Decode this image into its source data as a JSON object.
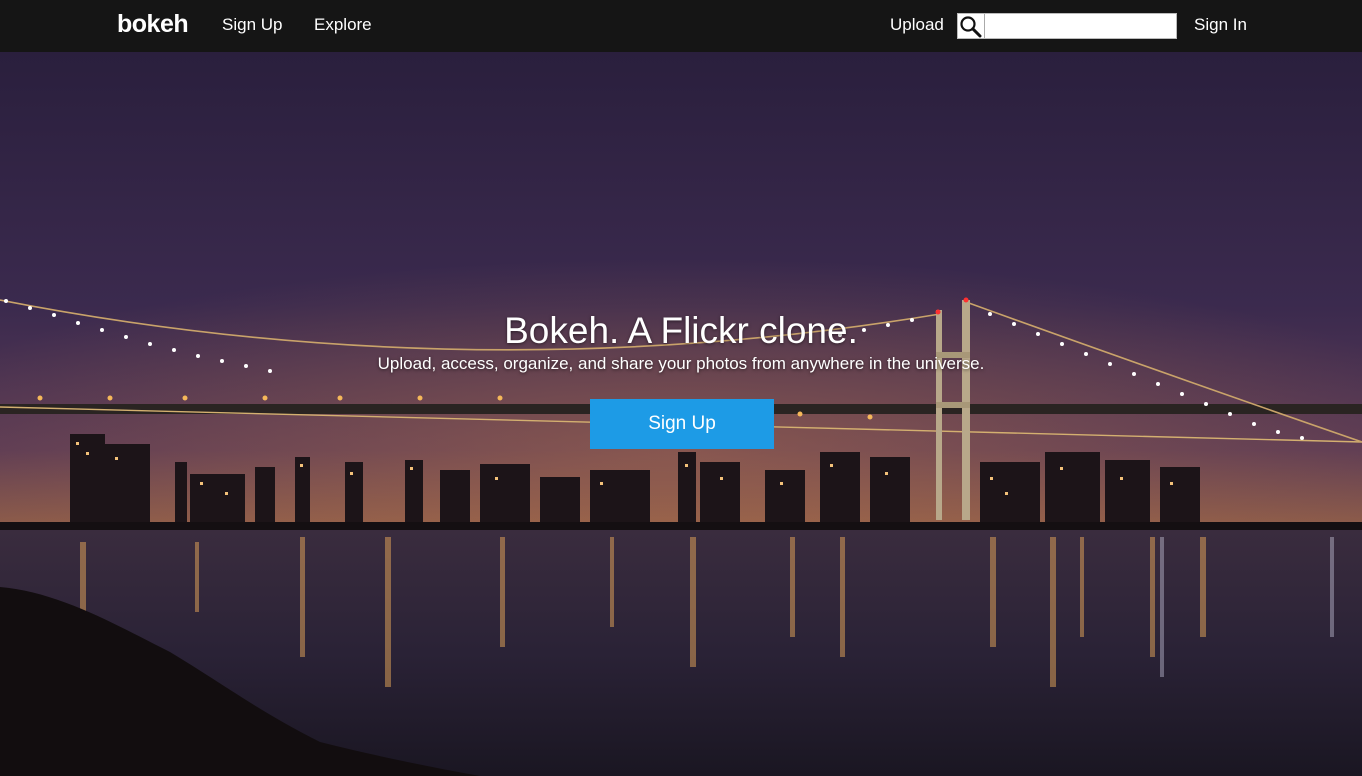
{
  "nav": {
    "logo": "bokeh",
    "signup_label": "Sign Up",
    "explore_label": "Explore",
    "upload_label": "Upload",
    "search_value": "",
    "signin_label": "Sign In"
  },
  "hero": {
    "title": "Bokeh. A Flickr clone.",
    "subtitle": "Upload, access, organize, and share your photos from anywhere in the universe.",
    "cta_label": "Sign Up"
  },
  "colors": {
    "nav_bg": "#151515",
    "cta": "#1d9be6"
  }
}
